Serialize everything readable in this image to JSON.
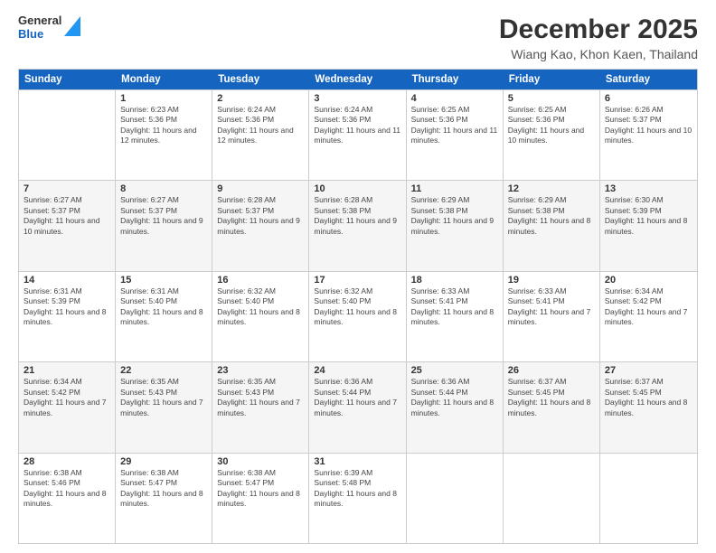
{
  "header": {
    "logo": {
      "general": "General",
      "blue": "Blue"
    },
    "title": "December 2025",
    "location": "Wiang Kao, Khon Kaen, Thailand"
  },
  "calendar": {
    "days": [
      "Sunday",
      "Monday",
      "Tuesday",
      "Wednesday",
      "Thursday",
      "Friday",
      "Saturday"
    ],
    "rows": [
      [
        {
          "num": "",
          "sunrise": "",
          "sunset": "",
          "daylight": ""
        },
        {
          "num": "1",
          "sunrise": "Sunrise: 6:23 AM",
          "sunset": "Sunset: 5:36 PM",
          "daylight": "Daylight: 11 hours and 12 minutes."
        },
        {
          "num": "2",
          "sunrise": "Sunrise: 6:24 AM",
          "sunset": "Sunset: 5:36 PM",
          "daylight": "Daylight: 11 hours and 12 minutes."
        },
        {
          "num": "3",
          "sunrise": "Sunrise: 6:24 AM",
          "sunset": "Sunset: 5:36 PM",
          "daylight": "Daylight: 11 hours and 11 minutes."
        },
        {
          "num": "4",
          "sunrise": "Sunrise: 6:25 AM",
          "sunset": "Sunset: 5:36 PM",
          "daylight": "Daylight: 11 hours and 11 minutes."
        },
        {
          "num": "5",
          "sunrise": "Sunrise: 6:25 AM",
          "sunset": "Sunset: 5:36 PM",
          "daylight": "Daylight: 11 hours and 10 minutes."
        },
        {
          "num": "6",
          "sunrise": "Sunrise: 6:26 AM",
          "sunset": "Sunset: 5:37 PM",
          "daylight": "Daylight: 11 hours and 10 minutes."
        }
      ],
      [
        {
          "num": "7",
          "sunrise": "Sunrise: 6:27 AM",
          "sunset": "Sunset: 5:37 PM",
          "daylight": "Daylight: 11 hours and 10 minutes."
        },
        {
          "num": "8",
          "sunrise": "Sunrise: 6:27 AM",
          "sunset": "Sunset: 5:37 PM",
          "daylight": "Daylight: 11 hours and 9 minutes."
        },
        {
          "num": "9",
          "sunrise": "Sunrise: 6:28 AM",
          "sunset": "Sunset: 5:37 PM",
          "daylight": "Daylight: 11 hours and 9 minutes."
        },
        {
          "num": "10",
          "sunrise": "Sunrise: 6:28 AM",
          "sunset": "Sunset: 5:38 PM",
          "daylight": "Daylight: 11 hours and 9 minutes."
        },
        {
          "num": "11",
          "sunrise": "Sunrise: 6:29 AM",
          "sunset": "Sunset: 5:38 PM",
          "daylight": "Daylight: 11 hours and 9 minutes."
        },
        {
          "num": "12",
          "sunrise": "Sunrise: 6:29 AM",
          "sunset": "Sunset: 5:38 PM",
          "daylight": "Daylight: 11 hours and 8 minutes."
        },
        {
          "num": "13",
          "sunrise": "Sunrise: 6:30 AM",
          "sunset": "Sunset: 5:39 PM",
          "daylight": "Daylight: 11 hours and 8 minutes."
        }
      ],
      [
        {
          "num": "14",
          "sunrise": "Sunrise: 6:31 AM",
          "sunset": "Sunset: 5:39 PM",
          "daylight": "Daylight: 11 hours and 8 minutes."
        },
        {
          "num": "15",
          "sunrise": "Sunrise: 6:31 AM",
          "sunset": "Sunset: 5:40 PM",
          "daylight": "Daylight: 11 hours and 8 minutes."
        },
        {
          "num": "16",
          "sunrise": "Sunrise: 6:32 AM",
          "sunset": "Sunset: 5:40 PM",
          "daylight": "Daylight: 11 hours and 8 minutes."
        },
        {
          "num": "17",
          "sunrise": "Sunrise: 6:32 AM",
          "sunset": "Sunset: 5:40 PM",
          "daylight": "Daylight: 11 hours and 8 minutes."
        },
        {
          "num": "18",
          "sunrise": "Sunrise: 6:33 AM",
          "sunset": "Sunset: 5:41 PM",
          "daylight": "Daylight: 11 hours and 8 minutes."
        },
        {
          "num": "19",
          "sunrise": "Sunrise: 6:33 AM",
          "sunset": "Sunset: 5:41 PM",
          "daylight": "Daylight: 11 hours and 7 minutes."
        },
        {
          "num": "20",
          "sunrise": "Sunrise: 6:34 AM",
          "sunset": "Sunset: 5:42 PM",
          "daylight": "Daylight: 11 hours and 7 minutes."
        }
      ],
      [
        {
          "num": "21",
          "sunrise": "Sunrise: 6:34 AM",
          "sunset": "Sunset: 5:42 PM",
          "daylight": "Daylight: 11 hours and 7 minutes."
        },
        {
          "num": "22",
          "sunrise": "Sunrise: 6:35 AM",
          "sunset": "Sunset: 5:43 PM",
          "daylight": "Daylight: 11 hours and 7 minutes."
        },
        {
          "num": "23",
          "sunrise": "Sunrise: 6:35 AM",
          "sunset": "Sunset: 5:43 PM",
          "daylight": "Daylight: 11 hours and 7 minutes."
        },
        {
          "num": "24",
          "sunrise": "Sunrise: 6:36 AM",
          "sunset": "Sunset: 5:44 PM",
          "daylight": "Daylight: 11 hours and 7 minutes."
        },
        {
          "num": "25",
          "sunrise": "Sunrise: 6:36 AM",
          "sunset": "Sunset: 5:44 PM",
          "daylight": "Daylight: 11 hours and 8 minutes."
        },
        {
          "num": "26",
          "sunrise": "Sunrise: 6:37 AM",
          "sunset": "Sunset: 5:45 PM",
          "daylight": "Daylight: 11 hours and 8 minutes."
        },
        {
          "num": "27",
          "sunrise": "Sunrise: 6:37 AM",
          "sunset": "Sunset: 5:45 PM",
          "daylight": "Daylight: 11 hours and 8 minutes."
        }
      ],
      [
        {
          "num": "28",
          "sunrise": "Sunrise: 6:38 AM",
          "sunset": "Sunset: 5:46 PM",
          "daylight": "Daylight: 11 hours and 8 minutes."
        },
        {
          "num": "29",
          "sunrise": "Sunrise: 6:38 AM",
          "sunset": "Sunset: 5:47 PM",
          "daylight": "Daylight: 11 hours and 8 minutes."
        },
        {
          "num": "30",
          "sunrise": "Sunrise: 6:38 AM",
          "sunset": "Sunset: 5:47 PM",
          "daylight": "Daylight: 11 hours and 8 minutes."
        },
        {
          "num": "31",
          "sunrise": "Sunrise: 6:39 AM",
          "sunset": "Sunset: 5:48 PM",
          "daylight": "Daylight: 11 hours and 8 minutes."
        },
        {
          "num": "",
          "sunrise": "",
          "sunset": "",
          "daylight": ""
        },
        {
          "num": "",
          "sunrise": "",
          "sunset": "",
          "daylight": ""
        },
        {
          "num": "",
          "sunrise": "",
          "sunset": "",
          "daylight": ""
        }
      ]
    ]
  }
}
